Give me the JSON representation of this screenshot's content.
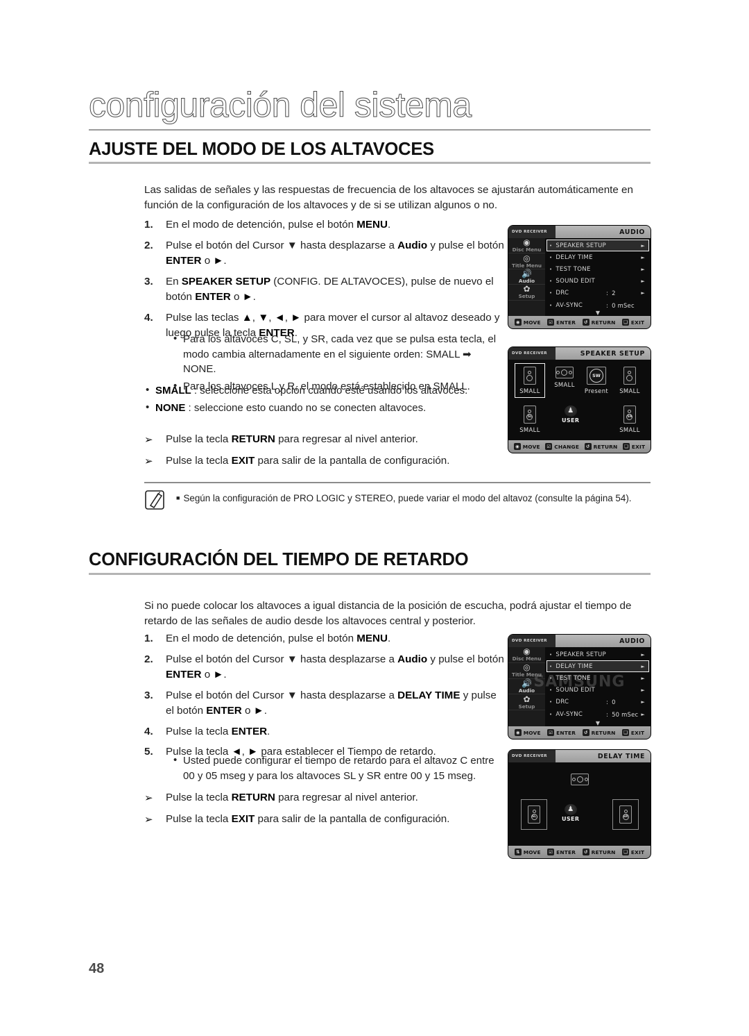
{
  "document": {
    "chapter_title": "configuración del sistema",
    "page_number": "48"
  },
  "section1": {
    "heading": "AJUSTE DEL MODO DE LOS ALTAVOCES",
    "intro": "Las salidas de señales y las respuestas de frecuencia de los altavoces se ajustarán automáticamente en función de la configuración de los altavoces y de si se utilizan algunos o no.",
    "steps": [
      {
        "num": "1.",
        "html": "En el modo de detención, pulse el botón <b>MENU</b>."
      },
      {
        "num": "2.",
        "html": "Pulse el botón del Cursor ▼ hasta desplazarse a <b>Audio</b> y pulse el botón <b>ENTER</b> o <b>►</b>."
      },
      {
        "num": "3.",
        "html": "En <b>SPEAKER SETUP</b> (CONFIG. DE ALTAVOCES), pulse de nuevo el botón <b>ENTER</b> o <b>►</b>."
      },
      {
        "num": "4.",
        "html": "Pulse las teclas <b>▲</b>, <b>▼</b>, <b>◄</b>, <b>►</b> para mover el cursor al altavoz deseado y luego pulse la tecla <b>ENTER</b>."
      }
    ],
    "sub_bullets": [
      "Para los altavoces C, SL, y SR, cada vez que se pulsa esta tecla, el modo cambia alternadamente en el siguiente orden: SMALL ➡ NONE.",
      "Para los altavoces L y R, el modo está establecido en SMALL."
    ],
    "mode_bullets": [
      {
        "term": "SMALL",
        "rest": " : seleccione esta opción cuando esté usando los altavoces."
      },
      {
        "term": "NONE",
        "rest": " : seleccione esto cuando no se conecten altavoces."
      }
    ],
    "arrows": [
      "Pulse la tecla <b>RETURN</b> para regresar al nivel anterior.",
      "Pulse la tecla <b>EXIT</b> para salir de la pantalla de configuración."
    ],
    "note": "Según la configuración de PRO LOGIC y STEREO, puede variar el modo del altavoz (consulte la página 54)."
  },
  "section2": {
    "heading": "CONFIGURACIÓN DEL TIEMPO DE RETARDO",
    "intro": "Si no puede colocar los altavoces a igual distancia de la posición de escucha, podrá ajustar el tiempo de retardo de las señales de audio desde los altavoces central y posterior.",
    "steps": [
      {
        "num": "1.",
        "html": "En el modo de detención, pulse el botón <b>MENU</b>."
      },
      {
        "num": "2.",
        "html": "Pulse el botón del Cursor ▼ hasta desplazarse a <b>Audio</b> y pulse el botón <b>ENTER</b> o <b>►</b>."
      },
      {
        "num": "3.",
        "html": "Pulse el botón del Cursor ▼ hasta desplazarse a <b>DELAY TIME</b> y pulse el botón <b>ENTER</b> o <b>►</b>."
      },
      {
        "num": "4.",
        "html": "Pulse la tecla <b>ENTER</b>."
      },
      {
        "num": "5.",
        "html": "Pulse la tecla <b>◄</b>, <b>►</b> para establecer el Tiempo de retardo."
      }
    ],
    "sub_bullets": [
      "Usted puede configurar el tiempo de retardo para el altavoz C entre 00 y 05 mseg y para los altavoces SL y SR entre 00 y 15 mseg."
    ],
    "arrows": [
      "Pulse la tecla <b>RETURN</b> para regresar al nivel anterior.",
      "Pulse la tecla <b>EXIT</b> para salir de la pantalla de configuración."
    ]
  },
  "osd_audio_1": {
    "brand": "DVD RECEIVER",
    "title": "AUDIO",
    "rail": [
      {
        "icon": "disc-menu-icon",
        "label": "Disc Menu"
      },
      {
        "icon": "title-menu-icon",
        "label": "Title Menu"
      },
      {
        "icon": "audio-icon",
        "label": "Audio"
      },
      {
        "icon": "setup-gear-icon",
        "label": "Setup"
      }
    ],
    "rows": [
      {
        "label": "SPEAKER SETUP",
        "value": "",
        "selected": true,
        "chevron": "►"
      },
      {
        "label": "DELAY TIME",
        "value": "",
        "selected": false,
        "chevron": "►"
      },
      {
        "label": "TEST TONE",
        "value": "",
        "selected": false,
        "chevron": "►"
      },
      {
        "label": "SOUND EDIT",
        "value": "",
        "selected": false,
        "chevron": "►"
      },
      {
        "label": "DRC",
        "value": "2",
        "selected": false,
        "chevron": "►"
      },
      {
        "label": "AV-SYNC",
        "value": "0 mSec",
        "selected": false,
        "chevron": ""
      }
    ],
    "buttons": [
      {
        "key": "◉",
        "label": "MOVE"
      },
      {
        "key": "☑",
        "label": "ENTER"
      },
      {
        "key": "↺",
        "label": "RETURN"
      },
      {
        "key": "❏",
        "label": "EXIT"
      }
    ]
  },
  "osd_speaker_setup": {
    "brand": "DVD RECEIVER",
    "title": "SPEAKER SETUP",
    "speakers": [
      {
        "pos": "L",
        "icon": "speaker-left-icon",
        "caption": "SMALL",
        "focused": true
      },
      {
        "pos": "C",
        "icon": "speaker-center-icon",
        "caption": "SMALL",
        "focused": false
      },
      {
        "pos": "SW",
        "icon": "subwoofer-icon",
        "caption": "Present",
        "focused": false
      },
      {
        "pos": "R",
        "icon": "speaker-right-icon",
        "caption": "SMALL",
        "focused": false
      },
      {
        "pos": "SL",
        "icon": "speaker-sl-icon",
        "caption": "SMALL",
        "focused": false
      },
      {
        "pos": "SR",
        "icon": "speaker-sr-icon",
        "caption": "SMALL",
        "focused": false
      }
    ],
    "listener_label": "USER",
    "buttons": [
      {
        "key": "◉",
        "label": "MOVE"
      },
      {
        "key": "☑",
        "label": "CHANGE"
      },
      {
        "key": "↺",
        "label": "RETURN"
      },
      {
        "key": "❏",
        "label": "EXIT"
      }
    ]
  },
  "osd_audio_2": {
    "brand": "DVD RECEIVER",
    "title": "AUDIO",
    "watermark": "SAMSUNG",
    "rail": [
      {
        "icon": "disc-menu-icon",
        "label": "Disc Menu"
      },
      {
        "icon": "title-menu-icon",
        "label": "Title Menu"
      },
      {
        "icon": "audio-icon",
        "label": "Audio"
      },
      {
        "icon": "setup-gear-icon",
        "label": "Setup"
      }
    ],
    "rows": [
      {
        "label": "SPEAKER SETUP",
        "value": "",
        "selected": false,
        "chevron": "►"
      },
      {
        "label": "DELAY TIME",
        "value": "",
        "selected": true,
        "chevron": "►"
      },
      {
        "label": "TEST TONE",
        "value": "",
        "selected": false,
        "chevron": "►"
      },
      {
        "label": "SOUND EDIT",
        "value": "",
        "selected": false,
        "chevron": "►"
      },
      {
        "label": "DRC",
        "value": "0",
        "selected": false,
        "chevron": "►"
      },
      {
        "label": "AV-SYNC",
        "value": "50 mSec",
        "selected": false,
        "chevron": "►"
      }
    ],
    "buttons": [
      {
        "key": "◉",
        "label": "MOVE"
      },
      {
        "key": "☑",
        "label": "ENTER"
      },
      {
        "key": "↺",
        "label": "RETURN"
      },
      {
        "key": "❏",
        "label": "EXIT"
      }
    ]
  },
  "osd_delay_time": {
    "brand": "DVD RECEIVER",
    "title": "DELAY TIME",
    "speakers": [
      {
        "pos": "C",
        "icon": "speaker-center-icon",
        "framed": false
      },
      {
        "pos": "SL",
        "icon": "speaker-sl-icon",
        "framed": true
      },
      {
        "pos": "SR",
        "icon": "speaker-sr-icon",
        "framed": true
      }
    ],
    "listener_label": "USER",
    "buttons": [
      {
        "key": "⇅",
        "label": "MOVE"
      },
      {
        "key": "☑",
        "label": "ENTER"
      },
      {
        "key": "↺",
        "label": "RETURN"
      },
      {
        "key": "❏",
        "label": "EXIT"
      }
    ]
  }
}
